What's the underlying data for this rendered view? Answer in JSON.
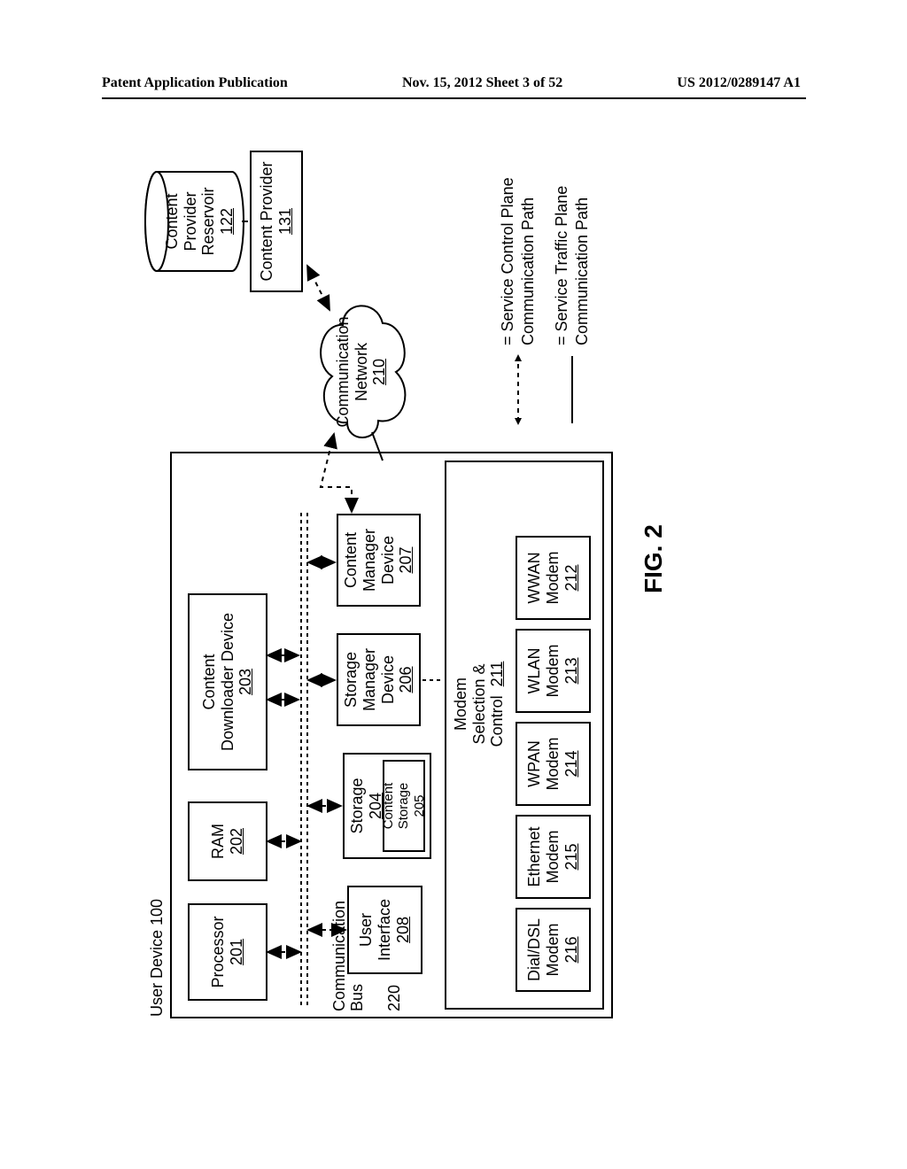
{
  "header": {
    "left": "Patent Application Publication",
    "center": "Nov. 15, 2012  Sheet 3 of 52",
    "right": "US 2012/0289147 A1"
  },
  "figure_label": "FIG. 2",
  "user_device": {
    "title": "User Device 100",
    "blocks": {
      "processor": {
        "label": "Processor",
        "ref": "201"
      },
      "ram": {
        "label": "RAM",
        "ref": "202"
      },
      "content_downloader": {
        "label": "Content\nDownloader Device",
        "ref": "203"
      },
      "user_interface": {
        "label": "User\nInterface",
        "ref": "208"
      },
      "storage": {
        "label": "Storage",
        "ref": "204"
      },
      "content_storage": {
        "label": "Content\nStorage",
        "ref": "205"
      },
      "storage_manager": {
        "label": "Storage\nManager\nDevice",
        "ref": "206"
      },
      "content_manager": {
        "label": "Content\nManager\nDevice",
        "ref": "207"
      },
      "modem_sel": {
        "label": "Modem\nSelection &\nControl",
        "ref": "211"
      },
      "dial_dsl": {
        "label": "Dial/DSL\nModem",
        "ref": "216"
      },
      "ethernet": {
        "label": "Ethernet\nModem",
        "ref": "215"
      },
      "wpan": {
        "label": "WPAN\nModem",
        "ref": "214"
      },
      "wlan": {
        "label": "WLAN\nModem",
        "ref": "213"
      },
      "wwan": {
        "label": "WWAN\nModem",
        "ref": "212"
      }
    },
    "bus_label": "Communication\nBus",
    "bus_ref": "220"
  },
  "network": {
    "label": "Communication\nNetwork",
    "ref": "210"
  },
  "content_provider": {
    "label": "Content Provider",
    "ref": "131"
  },
  "reservoir": {
    "label": "Content\nProvider\nReservoir",
    "ref": "122"
  },
  "legend": {
    "control": "= Service Control Plane\n   Communication Path",
    "traffic": "= Service Traffic Plane\n   Communication Path"
  }
}
